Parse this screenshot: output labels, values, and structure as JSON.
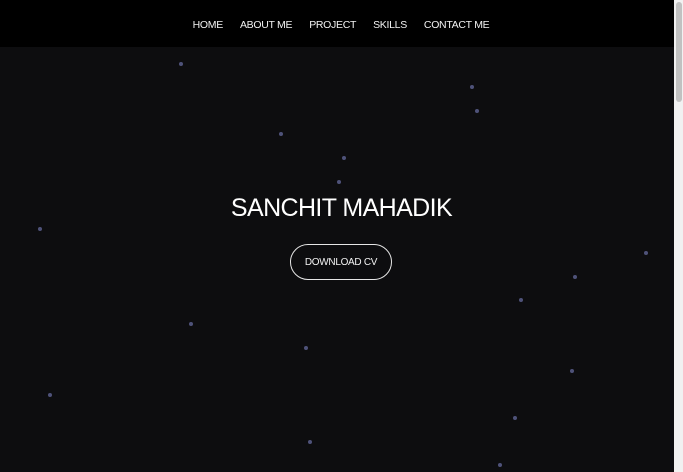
{
  "nav": {
    "items": [
      {
        "label": "HOME"
      },
      {
        "label": "ABOUT ME"
      },
      {
        "label": "PROJECT"
      },
      {
        "label": "SKILLS"
      },
      {
        "label": "CONTACT ME"
      }
    ]
  },
  "hero": {
    "title": "SANCHIT MAHADIK",
    "cv_button_label": "DOWNLOAD CV"
  },
  "colors": {
    "background": "#0d0d0f",
    "navbar": "#000000",
    "text": "#ffffff",
    "particle": "#5a5f8c"
  }
}
